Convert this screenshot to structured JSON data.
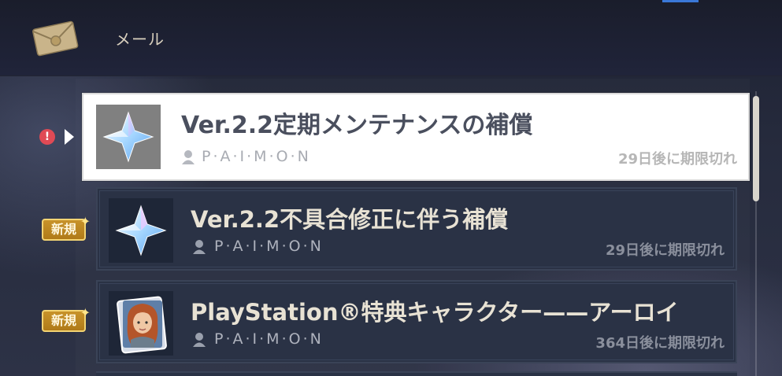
{
  "header": {
    "title": "メール"
  },
  "mails": [
    {
      "title": "Ver.2.2定期メンテナンスの補償",
      "sender": "P·A·I·M·O·N",
      "expiry": "29日後に期限切れ",
      "selected": true,
      "icon": "primogem-icon"
    },
    {
      "title": "Ver.2.2不具合修正に伴う補償",
      "sender": "P·A·I·M·O·N",
      "expiry": "29日後に期限切れ",
      "badge": "新規",
      "icon": "primogem-icon"
    },
    {
      "title": "PlayStation®特典キャラクター——アーロイ",
      "sender": "P·A·I·M·O·N",
      "expiry": "364日後に期限切れ",
      "badge": "新規",
      "icon": "aloy-portrait-icon"
    }
  ],
  "alert_badge": "!",
  "colors": {
    "badge_gold": "#c8932a",
    "alert_red": "#e04a55",
    "card_bg": "#2a3245",
    "selected_bg": "#ffffff"
  }
}
